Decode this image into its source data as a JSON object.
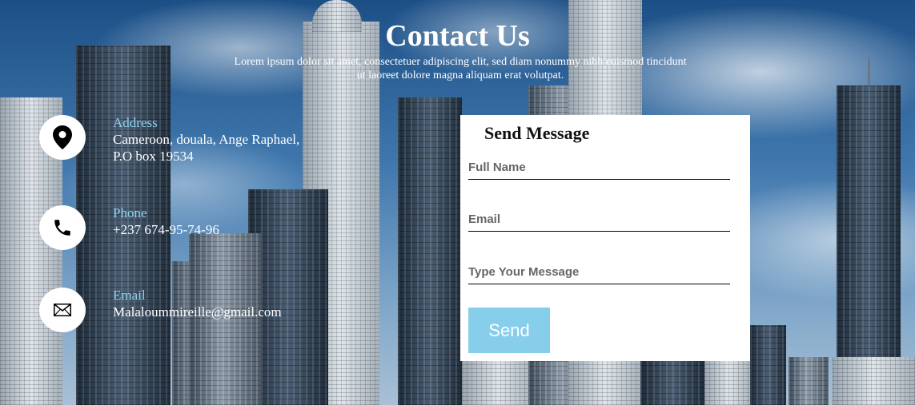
{
  "header": {
    "title": "Contact Us",
    "subtitle": "Lorem ipsum dolor sit amet, consectetuer adipiscing elit, sed diam nonummy nibh euismod tincidunt ut laoreet dolore magna aliquam erat volutpat."
  },
  "contact": [
    {
      "label": "Address",
      "value": "Cameroon, douala, Ange Raphael, P.O box 19534",
      "icon": "map-pin-icon"
    },
    {
      "label": "Phone",
      "value": "+237 674-95-74-96",
      "icon": "phone-icon"
    },
    {
      "label": "Email",
      "value": "Malaloummireille@gmail.com",
      "icon": "envelope-icon"
    }
  ],
  "form": {
    "title": "Send Message",
    "full_name_placeholder": "Full Name",
    "email_placeholder": "Email",
    "message_placeholder": "Type Your Message",
    "send_label": "Send"
  },
  "colors": {
    "accent": "#87ceeb",
    "label": "#8fd3f2",
    "form_bg": "#ffffff"
  }
}
